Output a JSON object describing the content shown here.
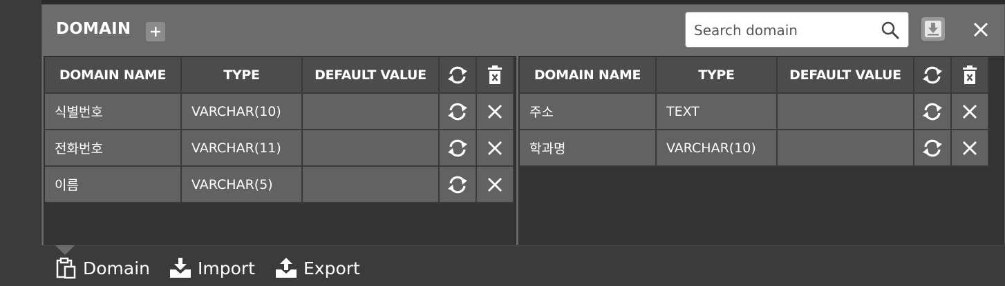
{
  "panel": {
    "title": "DOMAIN",
    "search_placeholder": "Search domain",
    "search_value": ""
  },
  "left_table": {
    "headers": [
      "DOMAIN NAME",
      "TYPE",
      "DEFAULT VALUE"
    ],
    "rows": [
      {
        "name": "식별번호",
        "type": "VARCHAR(10)",
        "default": ""
      },
      {
        "name": "전화번호",
        "type": "VARCHAR(11)",
        "default": ""
      },
      {
        "name": "이름",
        "type": "VARCHAR(5)",
        "default": ""
      }
    ]
  },
  "right_table": {
    "headers": [
      "DOMAIN NAME",
      "TYPE",
      "DEFAULT VALUE"
    ],
    "rows": [
      {
        "name": "주소",
        "type": "TEXT",
        "default": ""
      },
      {
        "name": "학과명",
        "type": "VARCHAR(10)",
        "default": ""
      }
    ]
  },
  "bottom_tabs": [
    {
      "label": "Domain",
      "icon": "clipboard-icon"
    },
    {
      "label": "Import",
      "icon": "import-icon"
    },
    {
      "label": "Export",
      "icon": "export-icon"
    }
  ],
  "colors": {
    "panel_bg": "#6c6c6c",
    "header_cell": "#4c4c4c",
    "body_cell": "#626262",
    "table_bg": "#333333"
  }
}
